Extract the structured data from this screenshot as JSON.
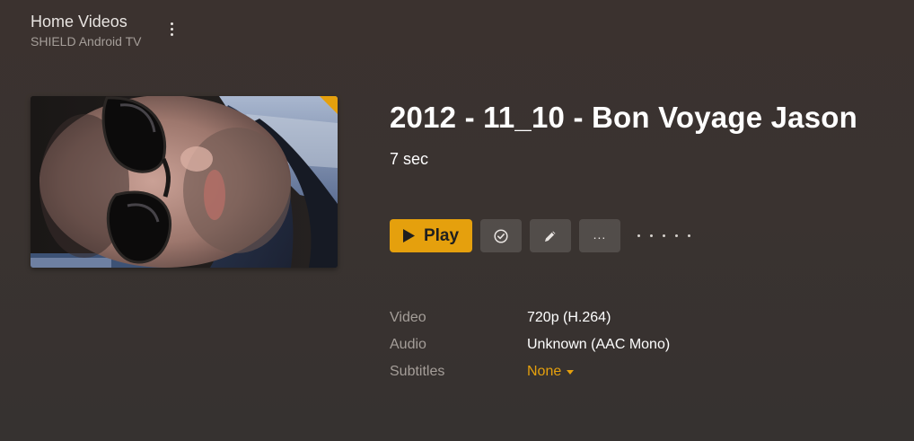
{
  "header": {
    "library_title": "Home Videos",
    "server_name": "SHIELD Android TV",
    "menu_icon": "more-vertical-icon"
  },
  "item": {
    "title": "2012 - 11_10 - Bon Voyage Jason",
    "duration": "7 sec"
  },
  "actions": {
    "play_label": "Play",
    "play_icon": "play-icon",
    "watched_icon": "check-circle-icon",
    "edit_icon": "pencil-icon",
    "more_label": "...",
    "rating_max": 5,
    "rating_value": 0
  },
  "metadata": [
    {
      "label": "Video",
      "value": "720p (H.264)"
    },
    {
      "label": "Audio",
      "value": "Unknown (AAC Mono)"
    },
    {
      "label": "Subtitles",
      "value": "None"
    }
  ],
  "colors": {
    "accent": "#e5a00d",
    "background": "#3a3330",
    "muted_text": "#a59e99"
  }
}
